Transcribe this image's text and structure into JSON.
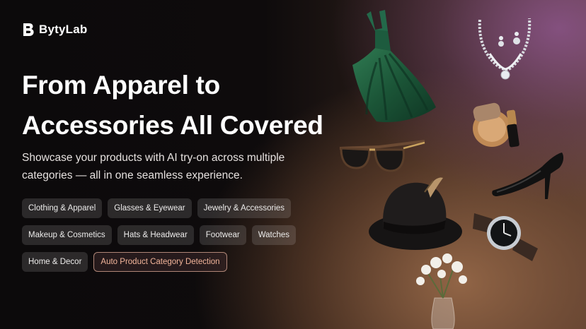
{
  "brand": {
    "name": "BytyLab"
  },
  "hero": {
    "title_line1": "From Apparel to",
    "title_line2": "Accessories All Covered",
    "subtitle": "Showcase your products with AI try-on across multiple categories — all in one seamless experience."
  },
  "categories": {
    "row1": [
      "Clothing & Apparel",
      "Glasses & Eyewear",
      "Jewelry & Accessories"
    ],
    "row2": [
      "Makeup & Cosmetics",
      "Hats & Headwear",
      "Footwear",
      "Watches"
    ],
    "row3": [
      "Home & Decor",
      "Auto Product Category Detection"
    ]
  },
  "colors": {
    "accent_highlight": "#f1b49a",
    "dress": "#1f5a3c",
    "background": "#0d0b0c"
  },
  "product_images": [
    "green-dress",
    "diamond-necklace",
    "compact-and-lipstick",
    "sunglasses",
    "black-stiletto-heel",
    "black-fedora-hat",
    "wristwatch",
    "flower-vase"
  ]
}
